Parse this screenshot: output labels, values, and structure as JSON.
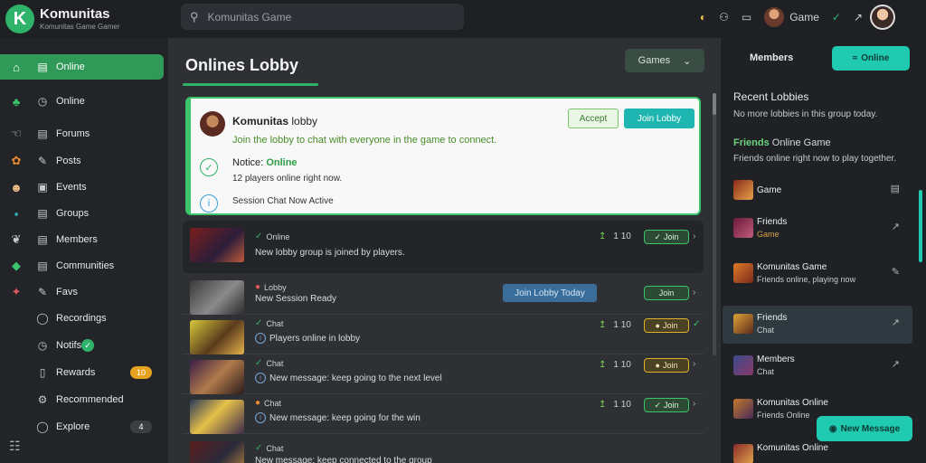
{
  "app": {
    "name": "Komunitas",
    "subtitle": "Komunitas Game Gamer"
  },
  "search": {
    "placeholder": "Komunitas Game"
  },
  "header": {
    "games_label": "Game"
  },
  "sidebar": {
    "items": [
      {
        "label": "Online",
        "active": true
      },
      {
        "label": "Online"
      },
      {
        "label": "Forums"
      },
      {
        "label": "Posts"
      },
      {
        "label": "Events"
      },
      {
        "label": "Groups"
      },
      {
        "label": "Members"
      },
      {
        "label": "Communities"
      },
      {
        "label": "Favs"
      },
      {
        "label": "Recordings"
      },
      {
        "label": "Notifs",
        "check": true
      },
      {
        "label": "Rewards",
        "badge": "10"
      },
      {
        "label": "Recommended"
      },
      {
        "label": "Explore",
        "badge": "4"
      }
    ]
  },
  "main": {
    "title": "Onlines Lobby",
    "games_dropdown": "Games",
    "highlight": {
      "name": "Komunitas",
      "name_suffix": "lobby",
      "message": "Join the lobby to chat with everyone in the game to connect.",
      "btn_secondary": "Accept",
      "btn_primary": "Join Lobby",
      "status_line_1_prefix": "Notice:",
      "status_line_1_green": "Online",
      "status_line_2": "12 players online right now.",
      "status_line_3": "Session Chat Now Active"
    },
    "rows": [
      {
        "meta": "Online",
        "desc": "New lobby group is joined by players.",
        "count": "1 10",
        "pill": "Join"
      },
      {
        "meta": "Lobby",
        "desc": "New Session Ready",
        "tag": "Join Lobby Today",
        "pill": "Join"
      },
      {
        "meta": "Chat",
        "desc": "Players online in lobby",
        "count": "1 10",
        "pill": "Join",
        "gold": true
      },
      {
        "meta": "Chat",
        "desc": "New message: keep going to the next level",
        "count": "1 10",
        "pill": "Join",
        "gold": true
      },
      {
        "meta": "Chat",
        "desc": "New message: keep going for the win",
        "count": "1 10",
        "pill": "Join"
      },
      {
        "meta": "Chat",
        "desc": "New message: keep connected to the group",
        "count": "",
        "pill": ""
      }
    ]
  },
  "right": {
    "header": "Members",
    "online_button": "Online",
    "section_title": "Recent Lobbies",
    "section_text": "No more lobbies in this group today.",
    "friends_title_green": "Friends",
    "friends_title_rest": "Online Game",
    "friends_text": "Friends online right now to play together.",
    "contacts": [
      {
        "name": "Game",
        "sub": ""
      },
      {
        "name": "Friends",
        "sub": "Game"
      },
      {
        "name": "Komunitas Game",
        "sub": "Friends online, playing now",
        "sub_white": true
      },
      {
        "name": "Friends",
        "sub": "Chat",
        "sub_white": true
      },
      {
        "name": "Members",
        "sub": "Chat",
        "sub_white": true
      },
      {
        "name": "Komunitas Online",
        "sub": "Friends Online",
        "sub_white": true
      },
      {
        "name": "Komunitas Online",
        "sub": ""
      }
    ],
    "float_button": "New Message"
  }
}
